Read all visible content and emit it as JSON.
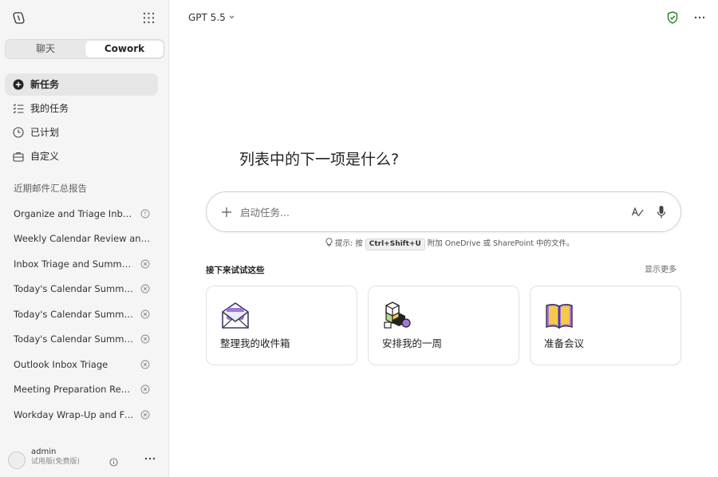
{
  "sidebar": {
    "tabs": {
      "chat": "聊天",
      "cowork": "Cowork"
    },
    "nav": [
      {
        "label": "新任务",
        "icon": "plus-circle-icon"
      },
      {
        "label": "我的任务",
        "icon": "task-list-icon"
      },
      {
        "label": "已计划",
        "icon": "clock-icon"
      },
      {
        "label": "自定义",
        "icon": "briefcase-icon"
      }
    ],
    "section_title": "近期邮件汇总报告",
    "history": [
      {
        "label": "Organize and Triage Inbox ...",
        "icon": "chat-bubble-icon"
      },
      {
        "label": "Weekly Calendar Review and Or...",
        "icon": ""
      },
      {
        "label": "Inbox Triage and Summary",
        "icon": "dismiss-circle-icon"
      },
      {
        "label": "Today's Calendar Summary",
        "icon": "dismiss-circle-icon"
      },
      {
        "label": "Today's Calendar Summary",
        "icon": "dismiss-circle-icon"
      },
      {
        "label": "Today's Calendar Summary",
        "icon": "dismiss-circle-icon"
      },
      {
        "label": "Outlook Inbox Triage",
        "icon": "dismiss-circle-icon"
      },
      {
        "label": "Meeting Preparation Review",
        "icon": "dismiss-circle-icon"
      },
      {
        "label": "Workday Wrap-Up and Fol...",
        "icon": "dismiss-circle-icon"
      }
    ],
    "user": {
      "name": "admin",
      "role": "试用版(免费版)"
    }
  },
  "main": {
    "model": "GPT 5.5",
    "headline": "列表中的下一项是什么?",
    "composer": {
      "placeholder": "启动任务..."
    },
    "hint": {
      "prefix": "提示: 按",
      "shortcut": "Ctrl+Shift+U",
      "suffix": "附加 OneDrive 或 SharePoint 中的文件。"
    },
    "try_title": "接下来试试这些",
    "show_more": "显示更多",
    "cards": [
      {
        "label": "整理我的收件箱",
        "icon": "envelope-icon"
      },
      {
        "label": "安排我的一周",
        "icon": "blocks-icon"
      },
      {
        "label": "准备会议",
        "icon": "book-icon"
      }
    ]
  },
  "colors": {
    "accent": "#107c10",
    "sidebar_bg": "#f5f5f5",
    "card_purple": "#a377d6",
    "card_yellow": "#f7c948"
  }
}
